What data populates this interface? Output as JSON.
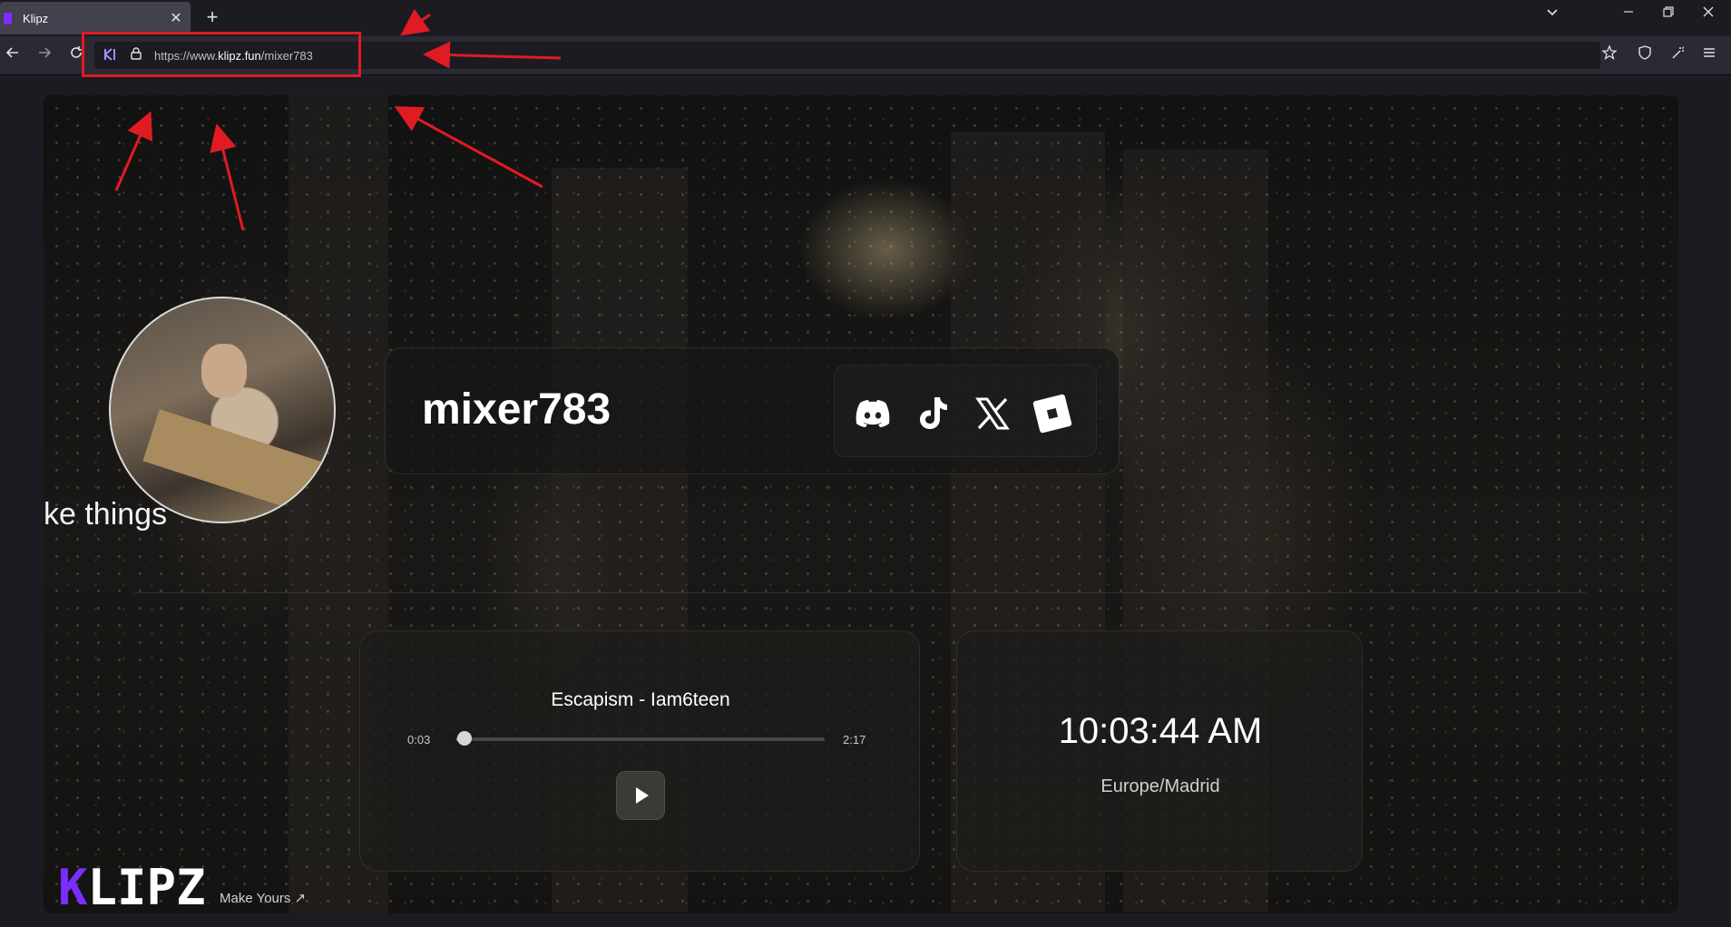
{
  "browser": {
    "tab_title": "Klipz",
    "tab_close": "✕",
    "new_tab": "+",
    "url_prefix": "https://www.",
    "url_domain": "klipz.fun",
    "url_path": "/mixer783",
    "icons": [
      "back-icon",
      "forward-icon",
      "reload-icon",
      "permissions-icon",
      "lock-icon",
      "bookmark-star-icon",
      "shield-icon",
      "extensions-icon",
      "menu-icon",
      "list-all-tabs-icon",
      "minimize-icon",
      "restore-icon",
      "close-window-icon"
    ]
  },
  "profile": {
    "username": "mixer783",
    "bio_fragment": "ke things",
    "socials": [
      "discord",
      "tiktok",
      "x",
      "roblox"
    ]
  },
  "music": {
    "title": "Escapism - Iam6teen",
    "current_time": "0:03",
    "total_time": "2:17",
    "progress": 0.022
  },
  "clock": {
    "time": "10:03:44 AM",
    "timezone": "Europe/Madrid"
  },
  "footer": {
    "brand": "KLIPZ",
    "make_yours": "Make Yours ↗"
  },
  "colors": {
    "annotation": "#e01b24",
    "brand_purple": "#7c2cff",
    "chrome_bg": "#1c1b22",
    "toolbar_bg": "#2b2a33"
  }
}
